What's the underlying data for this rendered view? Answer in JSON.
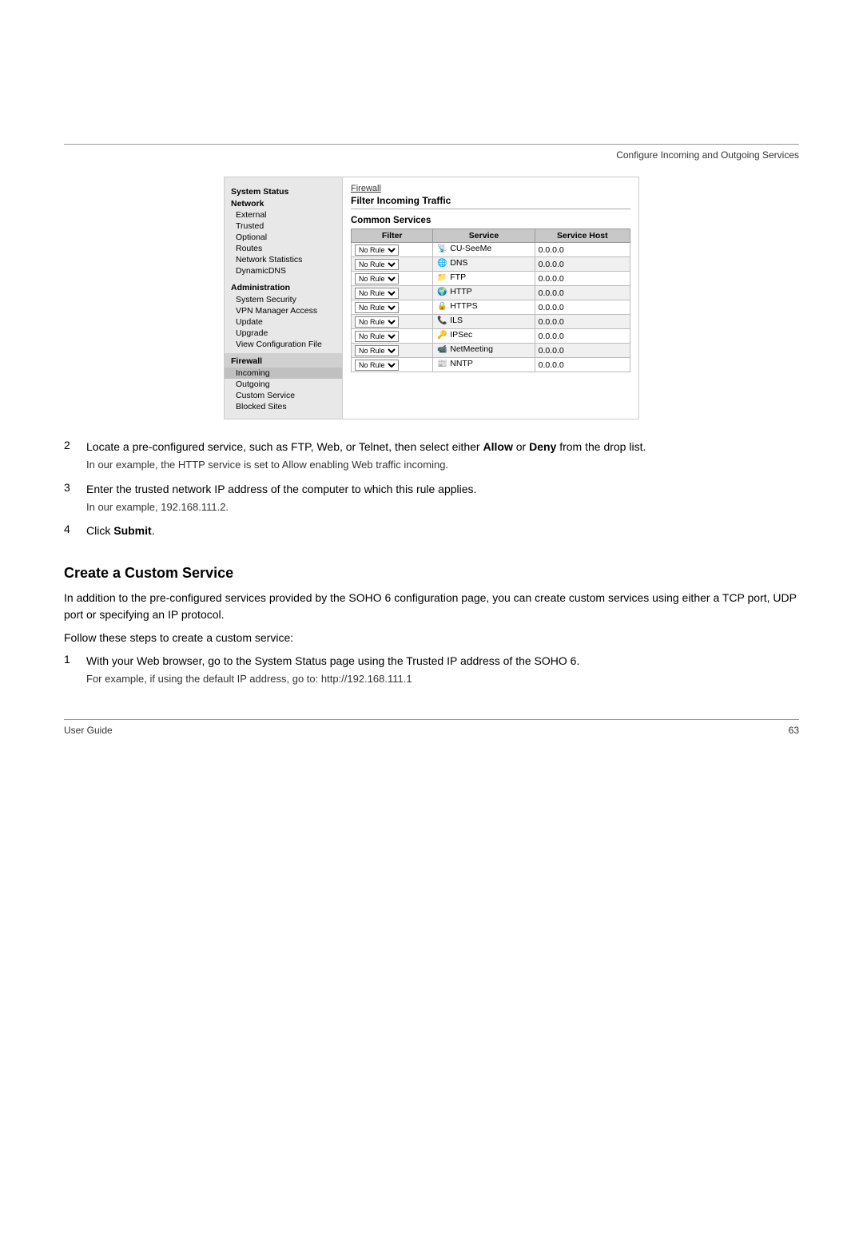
{
  "header": {
    "title": "Configure Incoming and Outgoing Services"
  },
  "screenshot": {
    "sidebar": {
      "sections": [
        {
          "label": "System Status",
          "type": "title",
          "items": []
        },
        {
          "label": "Network",
          "type": "bold",
          "items": [
            "External",
            "Trusted",
            "Optional",
            "Routes",
            "Network Statistics",
            "DynamicDNS"
          ]
        },
        {
          "label": "Administration",
          "type": "bold",
          "items": [
            "System Security",
            "VPN Manager Access",
            "Update",
            "Upgrade",
            "View Configuration File"
          ]
        },
        {
          "label": "Firewall",
          "type": "section",
          "items": [
            "Incoming",
            "Outgoing",
            "Custom Service",
            "Blocked Sites"
          ]
        }
      ]
    },
    "main": {
      "breadcrumb": "Firewall",
      "title": "Filter Incoming Traffic",
      "common_services_label": "Common Services",
      "table": {
        "headers": [
          "Filter",
          "Service",
          "Service Host"
        ],
        "rows": [
          {
            "filter": "No Rule",
            "icon": "📡",
            "service": "CU-SeeMe",
            "host": "0.0.0.0"
          },
          {
            "filter": "No Rule",
            "icon": "🌐",
            "service": "DNS",
            "host": "0.0.0.0"
          },
          {
            "filter": "No Rule",
            "icon": "📁",
            "service": "FTP",
            "host": "0.0.0.0"
          },
          {
            "filter": "No Rule",
            "icon": "🌍",
            "service": "HTTP",
            "host": "0.0.0.0"
          },
          {
            "filter": "No Rule",
            "icon": "🔒",
            "service": "HTTPS",
            "host": "0.0.0.0"
          },
          {
            "filter": "No Rule",
            "icon": "📞",
            "service": "ILS",
            "host": "0.0.0.0"
          },
          {
            "filter": "No Rule",
            "icon": "🔑",
            "service": "IPSec",
            "host": "0.0.0.0"
          },
          {
            "filter": "No Rule",
            "icon": "📹",
            "service": "NetMeeting",
            "host": "0.0.0.0"
          },
          {
            "filter": "No Rule",
            "icon": "📰",
            "service": "NNTP",
            "host": "0.0.0.0"
          }
        ]
      }
    }
  },
  "body": {
    "step2": {
      "number": "2",
      "main_text": "Locate a pre-configured service, such as FTP, Web, or Telnet, then select either ",
      "bold1": "Allow",
      "middle_text": " or ",
      "bold2": "Deny",
      "end_text": " from the drop list.",
      "sub_text": "In our example, the HTTP service is set to Allow enabling Web traffic incoming."
    },
    "step3": {
      "number": "3",
      "main_text": "Enter the trusted network IP address of the computer to which this rule applies.",
      "sub_text": "In our example, 192.168.111.2."
    },
    "step4": {
      "number": "4",
      "text_prefix": "Click ",
      "bold": "Submit",
      "text_suffix": "."
    },
    "section_heading": "Create a Custom Service",
    "para1": "In addition to the pre-configured services provided by the SOHO 6 configuration page, you can create custom services using either a TCP port, UDP port or specifying an IP protocol.",
    "para2": "Follow these steps to create a custom service:",
    "step1_custom": {
      "number": "1",
      "main_text": "With your Web browser, go to the System Status page using the Trusted IP address of the SOHO 6.",
      "sub_text": "For example, if using the default IP address, go to: http://192.168.111.1"
    }
  },
  "footer": {
    "left": "User Guide",
    "right": "63"
  }
}
